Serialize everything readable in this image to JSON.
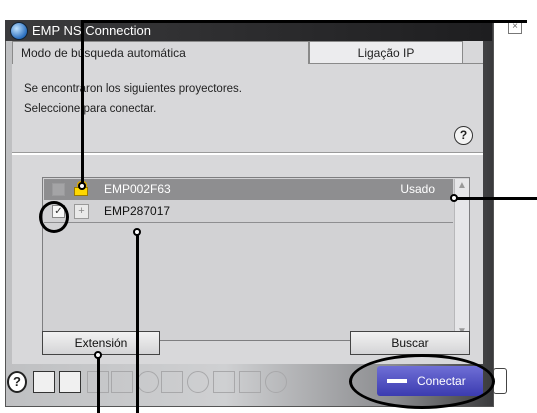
{
  "window": {
    "title": "EMP NS Connection",
    "close_glyph": "×"
  },
  "tabs": {
    "auto_search": "Modo de búsqueda automática",
    "ip_connect": "Ligação IP"
  },
  "message": {
    "line1": "Se encontraron los siguientes proyectores.",
    "line2": "Seleccione para conectar."
  },
  "help_glyph": "?",
  "projectors": [
    {
      "name": "EMP002F63",
      "status": "Usado",
      "locked": true,
      "selected": false,
      "enabled": false
    },
    {
      "name": "EMP287017",
      "status": "",
      "locked": false,
      "selected": true,
      "enabled": true
    }
  ],
  "checkbox_mark": "✓",
  "plus_glyph": "+",
  "buttons": {
    "extension": "Extensión",
    "search": "Buscar",
    "connect": "Conectar"
  },
  "toolbar": {
    "help_glyph": "?",
    "icons": [
      "help-icon",
      "network-lock-icon",
      "display-select-icon",
      "multi-screen-icon",
      "document-icon",
      "pause-icon",
      "mute-icon",
      "zoom-icon",
      "projector-settings-icon",
      "video-icon",
      "refresh-icon"
    ]
  },
  "colors": {
    "connect_button": "#4a4ac0",
    "selected_row": "#8e8e90",
    "title_bar": "#2a2a2c",
    "lock_icon": "#ffd800"
  }
}
